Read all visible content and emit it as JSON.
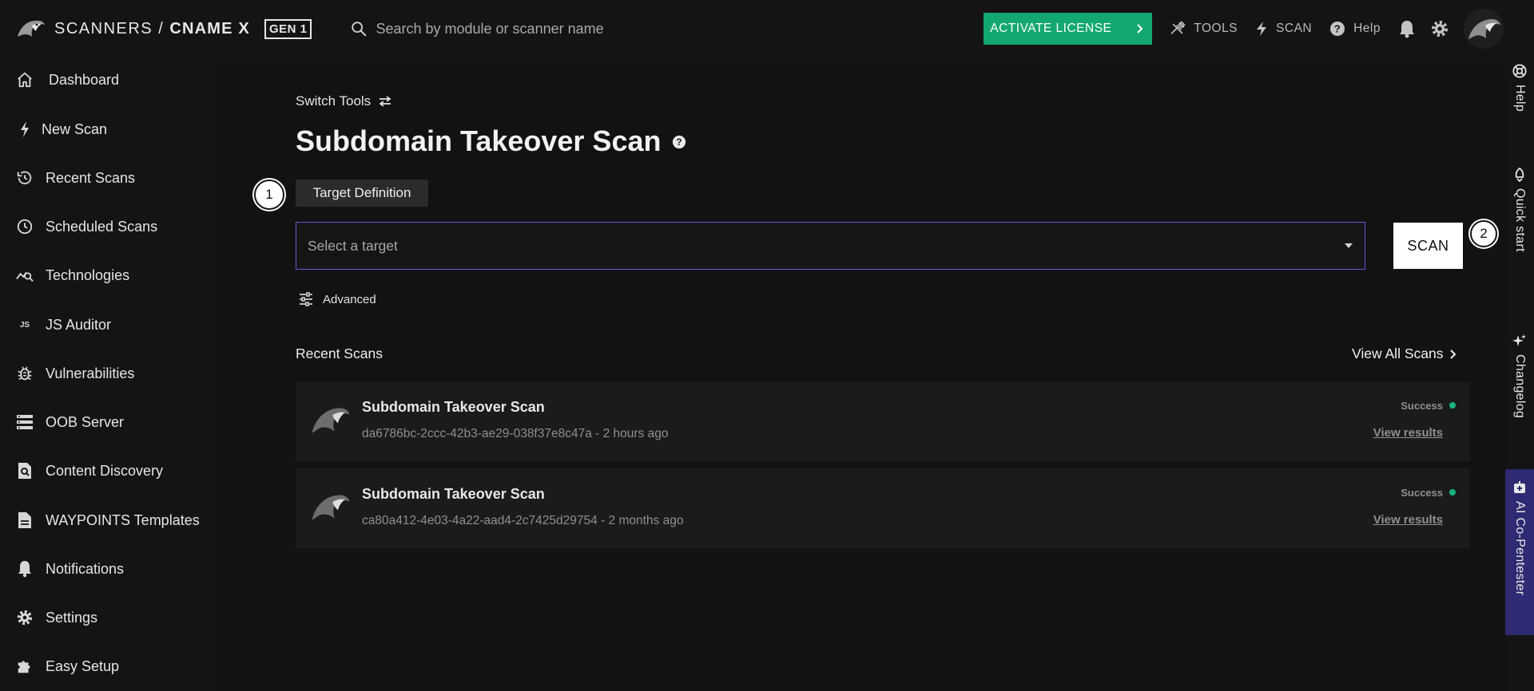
{
  "header": {
    "brand_prefix": "SCANNERS / ",
    "brand_name": "CNAME X",
    "gen_badge": "GEN 1",
    "search_placeholder": "Search by module or scanner name",
    "activate_label": "ACTIVATE LICENSE",
    "tools_label": "TOOLS",
    "scan_label": "SCAN",
    "help_label": "Help"
  },
  "sidebar": {
    "items": [
      {
        "label": "Dashboard",
        "icon": "home-icon"
      },
      {
        "label": "New Scan",
        "icon": "bolt-icon"
      },
      {
        "label": "Recent Scans",
        "icon": "history-icon"
      },
      {
        "label": "Scheduled Scans",
        "icon": "clock-icon"
      },
      {
        "label": "Technologies",
        "icon": "tech-search-icon"
      },
      {
        "label": "JS Auditor",
        "icon": "js-icon"
      },
      {
        "label": "Vulnerabilities",
        "icon": "bug-icon"
      },
      {
        "label": "OOB Server",
        "icon": "server-icon"
      },
      {
        "label": "Content Discovery",
        "icon": "file-search-icon"
      },
      {
        "label": "WAYPOINTS Templates",
        "icon": "document-icon"
      },
      {
        "label": "Notifications",
        "icon": "bell-icon"
      },
      {
        "label": "Settings",
        "icon": "gear-icon"
      },
      {
        "label": "Easy Setup",
        "icon": "puzzle-icon"
      }
    ],
    "js_icon_text": "JS"
  },
  "main": {
    "switch_tools": "Switch Tools",
    "title": "Subdomain Takeover Scan",
    "step1": "1",
    "step2": "2",
    "target_tab": "Target Definition",
    "target_placeholder": "Select a target",
    "scan_button": "SCAN",
    "advanced": "Advanced",
    "recent_title": "Recent Scans",
    "view_all": "View All Scans",
    "scans": [
      {
        "title": "Subdomain Takeover Scan",
        "subtitle": "da6786bc-2ccc-42b3-ae29-038f37e8c47a - 2 hours ago",
        "status": "Success",
        "link": "View results"
      },
      {
        "title": "Subdomain Takeover Scan",
        "subtitle": "ca80a412-4e03-4a22-aad4-2c7425d29754 - 2 months ago",
        "status": "Success",
        "link": "View results"
      }
    ]
  },
  "right_rail": {
    "help": "Help",
    "quick_start": "Quick start",
    "changelog": "Changelog",
    "ai": "AI Co-Pentester"
  },
  "colors": {
    "accent_green": "#13a86f",
    "select_border": "#6a55d9",
    "ai_panel": "#2e2a73",
    "status_success": "#16b47a"
  }
}
